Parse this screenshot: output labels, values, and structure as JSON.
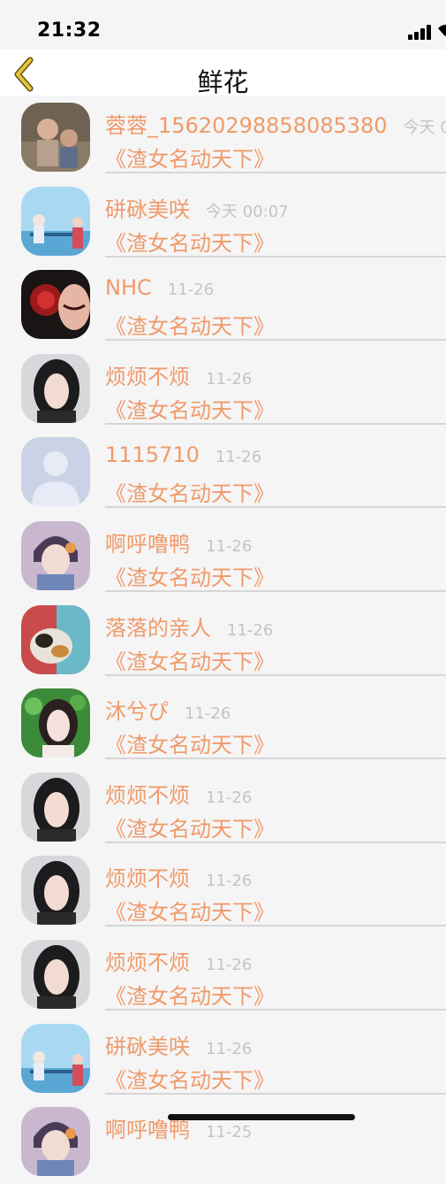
{
  "status_bar": {
    "time": "21:32"
  },
  "nav": {
    "title": "鲜花",
    "back_icon": "chevron-left-icon"
  },
  "colors": {
    "accent": "#f09a6a",
    "back": "#e5c43a",
    "date": "#c4c4c4"
  },
  "list": [
    {
      "name": "蓉蓉_1562029885808538​0",
      "date": "今天 0",
      "work": "《渣女名动天下》",
      "avatar": "photo-children"
    },
    {
      "name": "硑砯美咲",
      "date": "今天 00:07",
      "work": "《渣女名动天下》",
      "avatar": "anime-scene"
    },
    {
      "name": "NHC",
      "date": "11-26",
      "work": "《渣女名动天下》",
      "avatar": "red-flower-portrait"
    },
    {
      "name": "烦烦不烦",
      "date": "11-26",
      "work": "《渣女名动天下》",
      "avatar": "girl-dark-hair"
    },
    {
      "name": "1115710",
      "date": "11-26",
      "work": "《渣女名动天下》",
      "avatar": "default-user"
    },
    {
      "name": "啊呼噜鸭",
      "date": "11-26",
      "work": "《渣女名动天下》",
      "avatar": "anime-boy"
    },
    {
      "name": "落落的亲人",
      "date": "11-26",
      "work": "《渣女名动天下》",
      "avatar": "cat"
    },
    {
      "name": "沐兮ぴ",
      "date": "11-26",
      "work": "《渣女名动天下》",
      "avatar": "girl-green"
    },
    {
      "name": "烦烦不烦",
      "date": "11-26",
      "work": "《渣女名动天下》",
      "avatar": "girl-dark-hair"
    },
    {
      "name": "烦烦不烦",
      "date": "11-26",
      "work": "《渣女名动天下》",
      "avatar": "girl-dark-hair"
    },
    {
      "name": "烦烦不烦",
      "date": "11-26",
      "work": "《渣女名动天下》",
      "avatar": "girl-dark-hair"
    },
    {
      "name": "硑砯美咲",
      "date": "11-26",
      "work": "《渣女名动天下》",
      "avatar": "anime-scene"
    },
    {
      "name": "啊呼噜鸭",
      "date": "11-25",
      "work": "",
      "avatar": "anime-boy"
    }
  ]
}
